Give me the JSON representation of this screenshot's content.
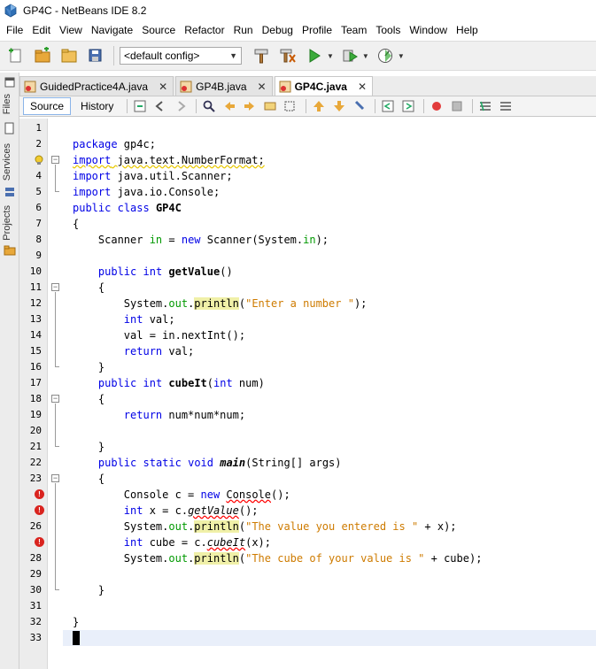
{
  "window": {
    "title": "GP4C - NetBeans IDE 8.2"
  },
  "menu": [
    "File",
    "Edit",
    "View",
    "Navigate",
    "Source",
    "Refactor",
    "Run",
    "Debug",
    "Profile",
    "Team",
    "Tools",
    "Window",
    "Help"
  ],
  "toolbar": {
    "config": "<default config>"
  },
  "side_panels": [
    "Files",
    "Services",
    "Projects"
  ],
  "tabs": [
    {
      "label": "GuidedPractice4A.java",
      "active": false
    },
    {
      "label": "GP4B.java",
      "active": false
    },
    {
      "label": "GP4C.java",
      "active": true
    }
  ],
  "editor_tabs": {
    "source": "Source",
    "history": "History"
  },
  "code_lines": [
    "",
    "package gp4c;",
    "import java.text.NumberFormat;",
    "import java.util.Scanner;",
    "import java.io.Console;",
    "public class GP4C",
    "{",
    "    Scanner in = new Scanner(System.in);",
    "",
    "    public int getValue()",
    "    {",
    "        System.out.println(\"Enter a number \");",
    "        int val;",
    "        val = in.nextInt();",
    "        return val;",
    "    }",
    "    public int cubeIt(int num)",
    "    {",
    "        return num*num*num;",
    "",
    "    }",
    "    public static void main(String[] args)",
    "    {",
    "        Console c = new Console();",
    "        int x = c.getValue();",
    "        System.out.println(\"The value you entered is \" + x);",
    "        int cube = c.cubeIt(x);",
    "        System.out.println(\"The cube of your value is \" + cube);",
    "",
    "    }",
    "",
    "}",
    ""
  ],
  "error_lines": [
    24,
    25,
    27
  ],
  "hint_lines": [
    3
  ],
  "current_line": 33,
  "colors": {
    "keyword": "#0000e6",
    "string": "#ce7b00",
    "field": "#009900",
    "error": "#d9241f"
  }
}
